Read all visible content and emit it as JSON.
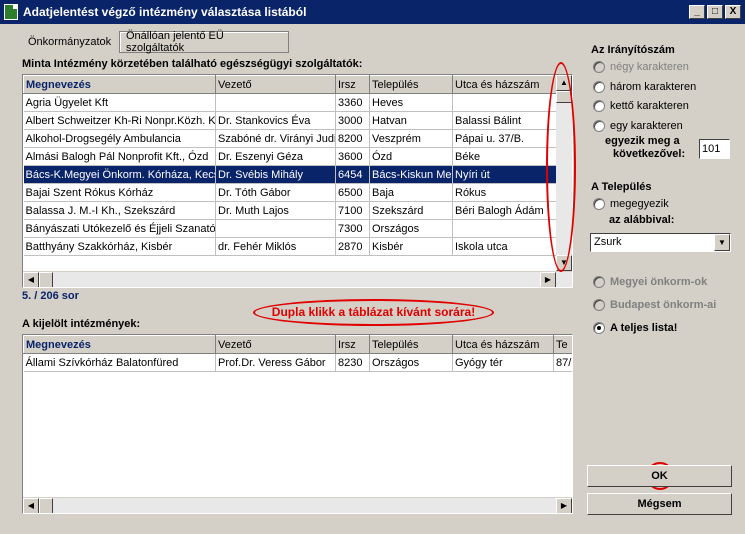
{
  "window": {
    "title": "Adatjelentést végző intézmény választása listából",
    "minimize": "_",
    "maximize": "□",
    "close": "X"
  },
  "tabs": [
    {
      "label": "Önkormányzatok"
    },
    {
      "label": "Önállóan jelentő EÜ szolgáltatók"
    }
  ],
  "main_list": {
    "heading": "Minta Intézmény körzetében található egészségügyi szolgáltatók:",
    "columns": [
      "Megnevezés",
      "Vezető",
      "Irsz",
      "Település",
      "Utca és házszám"
    ],
    "rows": [
      [
        "Agria Ügyelet Kft",
        "",
        "3360",
        "Heves",
        ""
      ],
      [
        "Albert Schweitzer Kh-Ri Nonpr.Közh. Kft",
        "Dr. Stankovics Éva",
        "3000",
        "Hatvan",
        "Balassi Bálint"
      ],
      [
        "Alkohol-Drogsegély Ambulancia",
        "Szabóné dr. Virányi Judit",
        "8200",
        "Veszprém",
        "Pápai u. 37/B."
      ],
      [
        "Almási Balogh Pál Nonprofit Kft., Ózd",
        "Dr. Eszenyi Géza",
        "3600",
        "Ózd",
        "Béke"
      ],
      [
        "Bács-K.Megyei Önkorm. Kórháza, Kecskemét",
        "Dr. Svébis Mihály",
        "6454",
        "Bács-Kiskun Megye",
        "Nyíri út"
      ],
      [
        "Bajai Szent Rókus Kórház",
        "Dr. Tóth Gábor",
        "6500",
        "Baja",
        "Rókus"
      ],
      [
        "Balassa J. M.-I Kh., Szekszárd",
        "Dr. Muth Lajos",
        "7100",
        "Szekszárd",
        "Béri Balogh Ádám"
      ],
      [
        "Bányászati Utókezelő és Éjjeli Szanatórium",
        "",
        "7300",
        "Országos",
        ""
      ],
      [
        "Batthyány Szakkórház, Kisbér",
        "dr. Fehér Miklós",
        "2870",
        "Kisbér",
        "Iskola utca"
      ]
    ],
    "selected_index": 4,
    "record_count": "5. / 206 sor"
  },
  "annotation": {
    "hint": "Dupla klikk a táblázat kívánt sorára!"
  },
  "selected_list": {
    "heading": "A kijelölt intézmények:",
    "columns": [
      "Megnevezés",
      "Vezető",
      "Irsz",
      "Település",
      "Utca és házszám",
      "Te"
    ],
    "rows": [
      [
        "Állami Szívkórház Balatonfüred",
        "Prof.Dr. Veress Gábor",
        "8230",
        "Országos",
        "Gyógy tér",
        "87/"
      ]
    ]
  },
  "right_panel": {
    "irsz_heading": "Az Irányítószám",
    "irsz_options": [
      "négy karakteren",
      "három karakteren",
      "kettő karakteren",
      "egy karakteren"
    ],
    "match_label_line1": "egyezik meg a",
    "match_label_line2": "következővel:",
    "match_value": "101",
    "telepules_heading": "A Település",
    "telepules_option": "megegyezik",
    "telepules_sub": "az alábbival:",
    "telepules_value": "Zsurk",
    "scope_options": [
      "Megyei önkorm-ok",
      "Budapest önkorm-ai",
      "A teljes lista!"
    ],
    "ok_label": "OK",
    "cancel_label": "Mégsem"
  },
  "colors": {
    "selection": "#0a246a",
    "annotation": "#e00000",
    "window_bg": "#d4d0c8"
  }
}
